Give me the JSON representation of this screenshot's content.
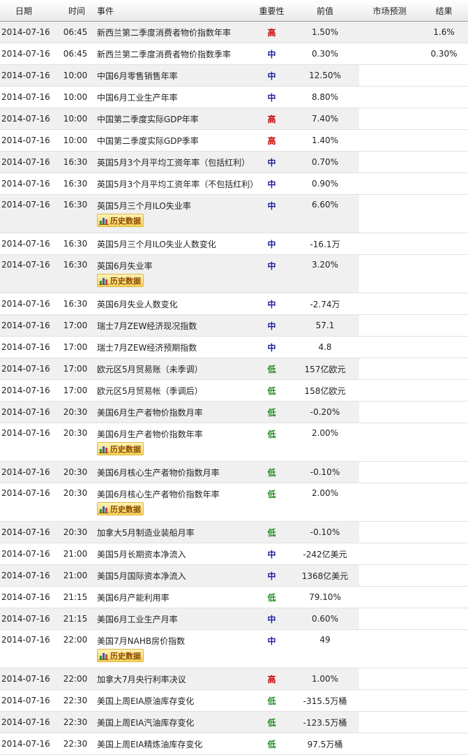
{
  "headers": {
    "date": "日期",
    "time": "时间",
    "event": "事件",
    "importance": "重要性",
    "previous": "前值",
    "forecast": "市场预测",
    "actual": "结果"
  },
  "history_label": "历史数据",
  "importance_colors": {
    "高": "#cc0000",
    "中": "#1a1aa0",
    "低": "#1d8a1d"
  },
  "rows": [
    {
      "date": "2014-07-16",
      "time": "06:45",
      "event": "新西兰第二季度消费者物价指数年率",
      "importance": "高",
      "previous": "1.50%",
      "forecast": "",
      "actual": "1.6%",
      "history": false
    },
    {
      "date": "2014-07-16",
      "time": "06:45",
      "event": "新西兰第二季度消费者物价指数季率",
      "importance": "中",
      "previous": "0.30%",
      "forecast": "",
      "actual": "0.30%",
      "history": false
    },
    {
      "date": "2014-07-16",
      "time": "10:00",
      "event": "中国6月零售销售年率",
      "importance": "中",
      "previous": "12.50%",
      "forecast": "",
      "actual": "",
      "history": false
    },
    {
      "date": "2014-07-16",
      "time": "10:00",
      "event": "中国6月工业生产年率",
      "importance": "中",
      "previous": "8.80%",
      "forecast": "",
      "actual": "",
      "history": false
    },
    {
      "date": "2014-07-16",
      "time": "10:00",
      "event": "中国第二季度实际GDP年率",
      "importance": "高",
      "previous": "7.40%",
      "forecast": "",
      "actual": "",
      "history": false
    },
    {
      "date": "2014-07-16",
      "time": "10:00",
      "event": "中国第二季度实际GDP季率",
      "importance": "高",
      "previous": "1.40%",
      "forecast": "",
      "actual": "",
      "history": false
    },
    {
      "date": "2014-07-16",
      "time": "16:30",
      "event": "英国5月3个月平均工资年率（包括红利）",
      "importance": "中",
      "previous": "0.70%",
      "forecast": "",
      "actual": "",
      "history": false
    },
    {
      "date": "2014-07-16",
      "time": "16:30",
      "event": "英国5月3个月平均工资年率（不包括红利）",
      "importance": "中",
      "previous": "0.90%",
      "forecast": "",
      "actual": "",
      "history": false
    },
    {
      "date": "2014-07-16",
      "time": "16:30",
      "event": "英国5月三个月ILO失业率",
      "importance": "中",
      "previous": "6.60%",
      "forecast": "",
      "actual": "",
      "history": true
    },
    {
      "date": "2014-07-16",
      "time": "16:30",
      "event": "英国5月三个月ILO失业人数变化",
      "importance": "中",
      "previous": "-16.1万",
      "forecast": "",
      "actual": "",
      "history": false
    },
    {
      "date": "2014-07-16",
      "time": "16:30",
      "event": "英国6月失业率",
      "importance": "中",
      "previous": "3.20%",
      "forecast": "",
      "actual": "",
      "history": true
    },
    {
      "date": "2014-07-16",
      "time": "16:30",
      "event": "英国6月失业人数变化",
      "importance": "中",
      "previous": "-2.74万",
      "forecast": "",
      "actual": "",
      "history": false
    },
    {
      "date": "2014-07-16",
      "time": "17:00",
      "event": "瑞士7月ZEW经济现况指数",
      "importance": "中",
      "previous": "57.1",
      "forecast": "",
      "actual": "",
      "history": false
    },
    {
      "date": "2014-07-16",
      "time": "17:00",
      "event": "瑞士7月ZEW经济预期指数",
      "importance": "中",
      "previous": "4.8",
      "forecast": "",
      "actual": "",
      "history": false
    },
    {
      "date": "2014-07-16",
      "time": "17:00",
      "event": "欧元区5月贸易账（未季调）",
      "importance": "低",
      "previous": "157亿欧元",
      "forecast": "",
      "actual": "",
      "history": false
    },
    {
      "date": "2014-07-16",
      "time": "17:00",
      "event": "欧元区5月贸易帐（季调后）",
      "importance": "低",
      "previous": "158亿欧元",
      "forecast": "",
      "actual": "",
      "history": false
    },
    {
      "date": "2014-07-16",
      "time": "20:30",
      "event": "美国6月生产者物价指数月率",
      "importance": "低",
      "previous": "-0.20%",
      "forecast": "",
      "actual": "",
      "history": false
    },
    {
      "date": "2014-07-16",
      "time": "20:30",
      "event": "美国6月生产者物价指数年率",
      "importance": "低",
      "previous": "2.00%",
      "forecast": "",
      "actual": "",
      "history": true
    },
    {
      "date": "2014-07-16",
      "time": "20:30",
      "event": "美国6月核心生产者物价指数月率",
      "importance": "低",
      "previous": "-0.10%",
      "forecast": "",
      "actual": "",
      "history": false
    },
    {
      "date": "2014-07-16",
      "time": "20:30",
      "event": "美国6月核心生产者物价指数年率",
      "importance": "低",
      "previous": "2.00%",
      "forecast": "",
      "actual": "",
      "history": true
    },
    {
      "date": "2014-07-16",
      "time": "20:30",
      "event": "加拿大5月制造业装船月率",
      "importance": "低",
      "previous": "-0.10%",
      "forecast": "",
      "actual": "",
      "history": false
    },
    {
      "date": "2014-07-16",
      "time": "21:00",
      "event": "美国5月长期资本净流入",
      "importance": "中",
      "previous": "-242亿美元",
      "forecast": "",
      "actual": "",
      "history": false
    },
    {
      "date": "2014-07-16",
      "time": "21:00",
      "event": "美国5月国际资本净流入",
      "importance": "中",
      "previous": "1368亿美元",
      "forecast": "",
      "actual": "",
      "history": false
    },
    {
      "date": "2014-07-16",
      "time": "21:15",
      "event": "美国6月产能利用率",
      "importance": "低",
      "previous": "79.10%",
      "forecast": "",
      "actual": "",
      "history": false
    },
    {
      "date": "2014-07-16",
      "time": "21:15",
      "event": "美国6月工业生产月率",
      "importance": "中",
      "previous": "0.60%",
      "forecast": "",
      "actual": "",
      "history": false
    },
    {
      "date": "2014-07-16",
      "time": "22:00",
      "event": "美国7月NAHB房价指数",
      "importance": "中",
      "previous": "49",
      "forecast": "",
      "actual": "",
      "history": true
    },
    {
      "date": "2014-07-16",
      "time": "22:00",
      "event": "加拿大7月央行利率决议",
      "importance": "高",
      "previous": "1.00%",
      "forecast": "",
      "actual": "",
      "history": false
    },
    {
      "date": "2014-07-16",
      "time": "22:30",
      "event": "美国上周EIA原油库存变化",
      "importance": "低",
      "previous": "-315.5万桶",
      "forecast": "",
      "actual": "",
      "history": false
    },
    {
      "date": "2014-07-16",
      "time": "22:30",
      "event": "美国上周EIA汽油库存变化",
      "importance": "低",
      "previous": "-123.5万桶",
      "forecast": "",
      "actual": "",
      "history": false
    },
    {
      "date": "2014-07-16",
      "time": "22:30",
      "event": "美国上周EIA精炼油库存变化",
      "importance": "低",
      "previous": "97.5万桶",
      "forecast": "",
      "actual": "",
      "history": false
    }
  ]
}
